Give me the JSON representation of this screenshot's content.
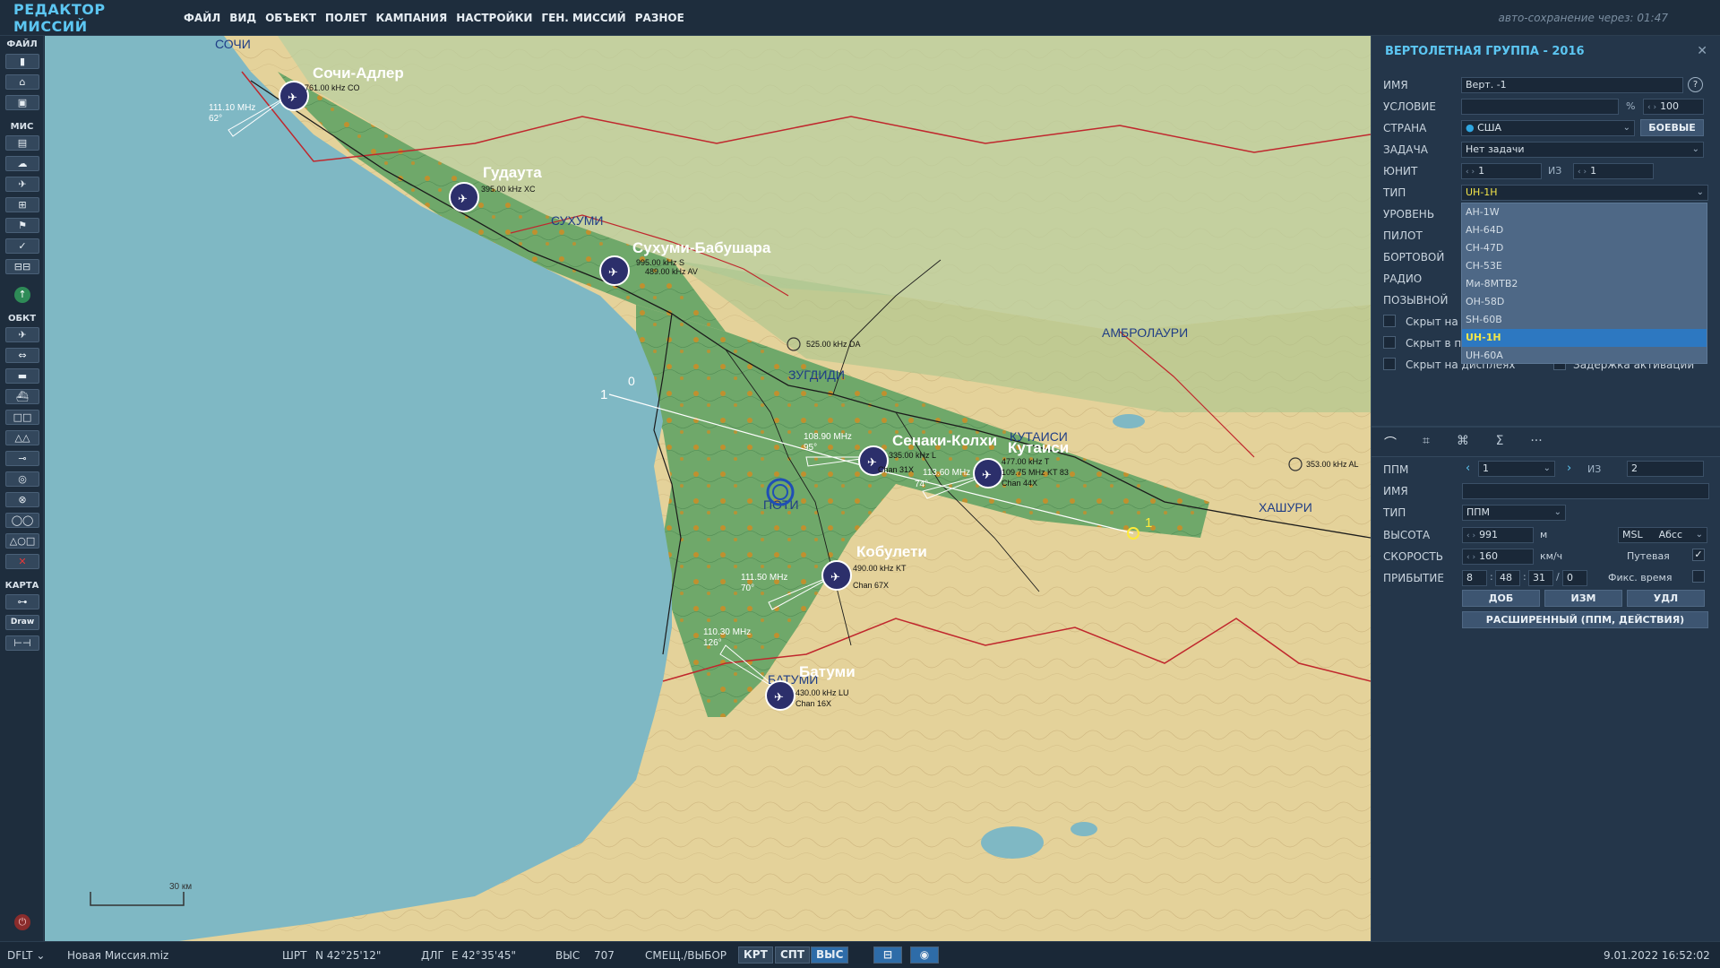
{
  "app": {
    "title": "РЕДАКТОР МИССИЙ",
    "autosave": "авто-сохранение через:  01:47"
  },
  "menu": [
    "ФАЙЛ",
    "ВИД",
    "ОБЪЕКТ",
    "ПОЛЕТ",
    "КАМПАНИЯ",
    "НАСТРОЙКИ",
    "ГЕН. МИССИЙ",
    "РАЗНОЕ"
  ],
  "toolbar": {
    "sections": [
      "ФАЙЛ",
      "МИС",
      "ОБКТ",
      "КАРТА"
    ],
    "draw_label": "Draw"
  },
  "map": {
    "scale_label": "30 км",
    "cities": [
      "СОЧИ",
      "СУХУМИ",
      "ЗУГДИДИ",
      "ПОТИ",
      "КУТАИСИ",
      "БАТУМИ",
      "АМБРОЛАУРИ",
      "ХАШУРИ"
    ],
    "airfields": [
      {
        "name": "Сочи-Адлер",
        "freq": "761.00 kHz CO"
      },
      {
        "name": "Гудаута",
        "freq": "395.00 kHz XC"
      },
      {
        "name": "Сухуми-Бабушара",
        "freq": "995.00 kHz S",
        "freq2": "489.00 kHz AV"
      },
      {
        "name": "Сенаки-Колхи",
        "freq": "335.00 kHz L",
        "freq2": "Chan 31X",
        "freq3": "108.90 MHz",
        "freq4": "95°"
      },
      {
        "name": "Кутаиси",
        "freq": "477.00 kHz T",
        "freq2": "109.75 MHz KT 83",
        "freq3": "Chan 44X",
        "freq4": "74°"
      },
      {
        "name": "Кобулети",
        "freq": "490.00 kHz KT",
        "freq2": "Chan 67X",
        "freq3": "111.50 MHz",
        "freq4": "70°"
      },
      {
        "name": "Батуми",
        "freq": "430.00 kHz LU",
        "freq2": "Chan 16X",
        "freq3": "110.30 MHz",
        "freq4": "126°"
      }
    ],
    "ils_sochi": {
      "freq": "111.10 MHz",
      "deg": "62°"
    },
    "ndb_zugdidi": "525.00 kHz DA",
    "ndb_east": "353.00 kHz AL",
    "route_labels": [
      "0",
      "1",
      "1"
    ],
    "kutaisi_extra": "113.60 MHz"
  },
  "panel": {
    "title": "ВЕРТОЛЕТНАЯ ГРУППА - 2016",
    "labels": {
      "name": "ИМЯ",
      "condition": "УСЛОВИЕ",
      "country": "СТРАНА",
      "task": "ЗАДАЧА",
      "unit": "ЮНИТ",
      "type": "ТИП",
      "level": "УРОВЕНЬ",
      "pilot": "ПИЛОТ",
      "board": "БОРТОВОЙ",
      "radio": "РАДИО",
      "callsign": "ПОЗЫВНОЙ",
      "of": "ИЗ"
    },
    "values": {
      "name": "Верт. -1",
      "condition": "",
      "percent": "%",
      "prob": "100",
      "country": "США",
      "coalition": "БОЕВЫЕ",
      "task": "Нет задачи",
      "unit": "1",
      "unit_of": "1",
      "type": "UH-1H"
    },
    "type_options": [
      "AH-1W",
      "AH-64D",
      "CH-47D",
      "CH-53E",
      "Ми-8МТВ2",
      "OH-58D",
      "SH-60B",
      "UH-1H",
      "UH-60A"
    ],
    "checks": [
      "Скрыт на",
      "Скрыт в п",
      "Скрыт на дисплеях",
      "Задержка активации"
    ],
    "wp": {
      "labels": {
        "ppm": "ППМ",
        "of": "ИЗ",
        "name": "ИМЯ",
        "type": "ТИП",
        "alt": "ВЫСОТА",
        "speed": "СКОРОСТЬ",
        "arrival": "ПРИБЫТИЕ"
      },
      "ppm": "1",
      "ppm_of": "2",
      "name": "",
      "type": "ППМ",
      "alt": "991",
      "alt_unit": "м",
      "alt_ref": "MSL",
      "alt_mode": "Абсс",
      "speed": "160",
      "speed_unit": "км/ч",
      "speed_mode": "Путевая",
      "arrival": {
        "h": "8",
        "m": "48",
        "s": "31",
        "d": "0"
      },
      "fixed_time": "Фикс. время",
      "btn_add": "ДОБ",
      "btn_edit": "ИЗМ",
      "btn_del": "УДЛ",
      "btn_ext": "РАСШИРЕННЫЙ (ППМ, ДЕЙСТВИЯ)"
    }
  },
  "status": {
    "profile": "DFLT",
    "file": "Новая Миссия.miz",
    "lat_label": "ШРТ",
    "lat": "N 42°25'12\"",
    "lon_label": "ДЛГ",
    "lon": "E 42°35'45\"",
    "alt_label": "ВЫС",
    "alt": "707",
    "mode": "СМЕЩ./ВЫБОР",
    "b1": "КРТ",
    "b2": "СПТ",
    "b3": "ВЫС",
    "datetime": "9.01.2022 16:52:02"
  }
}
